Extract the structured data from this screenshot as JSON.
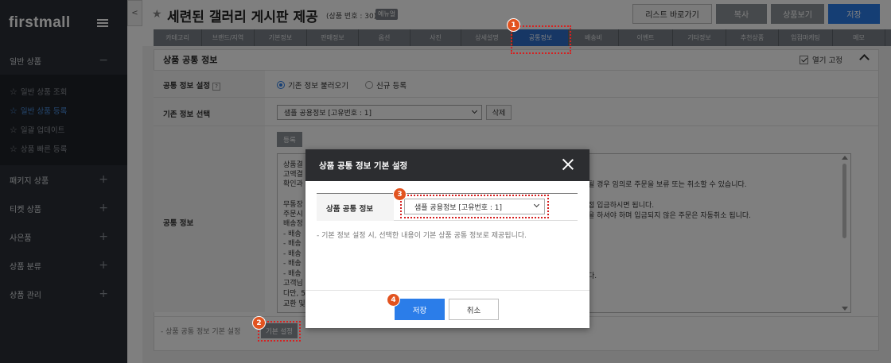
{
  "sidebar": {
    "logo": "firstmall",
    "sections": [
      {
        "label": "일반 상품",
        "sign": "−"
      },
      {
        "label": "패키지 상품",
        "sign": "+"
      },
      {
        "label": "티켓 상품",
        "sign": "+"
      },
      {
        "label": "사은품",
        "sign": "+"
      },
      {
        "label": "상품 분류",
        "sign": "+"
      },
      {
        "label": "상품 관리",
        "sign": "+"
      }
    ],
    "subitems": [
      {
        "label": "일반 상품 조회"
      },
      {
        "label": "일반 상품 등록"
      },
      {
        "label": "일괄 업데이트"
      },
      {
        "label": "상품 빠른 등록"
      }
    ]
  },
  "header": {
    "collapse": "<",
    "title": "세련된 갤러리 게시판 제공",
    "product_no": "(상품 번호 : 30)",
    "tag": "예뉴얼",
    "buttons": {
      "list": "리스트 바로가기",
      "copy": "복사",
      "view": "상품보기",
      "save": "저장"
    }
  },
  "tabs": [
    "카테고리",
    "브랜드/지역",
    "기본정보",
    "판매정보",
    "옵션",
    "사진",
    "상세설명",
    "공통정보",
    "배송비",
    "이벤트",
    "기타정보",
    "추천상품",
    "입점마케팅",
    "메모"
  ],
  "panel": {
    "title": "상품 공통 정보",
    "open_fix": "열기 고정",
    "row1_label": "공통 정보 설정",
    "help": "?",
    "radio_existing": "기존 정보 불러오기",
    "radio_new": "신규 등록",
    "row2_label": "기존 정보 선택",
    "select_value": "샘플 공용정보  [고유번호 : 1]",
    "delete_btn": "삭제",
    "row3_label": "공통 정보",
    "register_btn": "등록",
    "textarea_lines": [
      "상품결",
      "고액결",
      "확인과",
      "",
      "무통장",
      "주문시",
      "배송정",
      "- 배송",
      "- 배송",
      "- 배송",
      "- 배송",
      "- 배송",
      "고객님",
      "다만, 5",
      "교환 및"
    ],
    "textarea_right_1": "될 경우 임의로 주문을 보류 또는 취소할 수 있습니다.",
    "textarea_right_2": "접 입금하시면 됩니다.",
    "textarea_right_3": "을 하셔야 하며 입금되지 않은 주문은 자동취소 됩니다.",
    "textarea_right_4": "다.",
    "bottom_note": "-  상품 공통 정보 기본 설정",
    "basic_btn": "기본 설정"
  },
  "modal": {
    "title": "상품 공통 정보 기본 설정",
    "label": "상품 공통 정보",
    "select_value": "샘플 공용정보  [고유번호 : 1]",
    "note": "-  기본 정보 설정 시, 선택한 내용이 기본 상품 공통 정보로 제공됩니다.",
    "save": "저장",
    "cancel": "취소"
  },
  "annotations": {
    "badge1": "1",
    "badge2": "2",
    "badge3": "3",
    "badge4": "4",
    "color": "#e2531f"
  }
}
